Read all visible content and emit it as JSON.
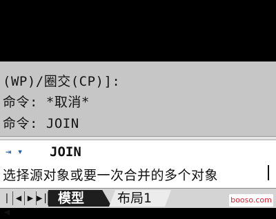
{
  "history": {
    "lines": [
      "(WP)/圈交(CP)]:",
      "命令: *取消*",
      "命令: JOIN"
    ]
  },
  "command_line": {
    "icon": "command-line-arrow-icon",
    "icon_glyph": "⇥ ▾",
    "command_name": "JOIN",
    "prompt": "选择源对象或要一次合并的多个对象"
  },
  "tabs": [
    {
      "label": "模型",
      "active": true
    },
    {
      "label": "布局1",
      "active": false
    }
  ],
  "nav_buttons": [
    "|◀",
    "◀",
    "▶",
    "▶|"
  ],
  "watermark": "booso.com",
  "colors": {
    "drawing_bg": "#000000",
    "history_bg": "#c6c6c6",
    "command_bg": "#ffffff",
    "accent": "#1b5fa8"
  }
}
